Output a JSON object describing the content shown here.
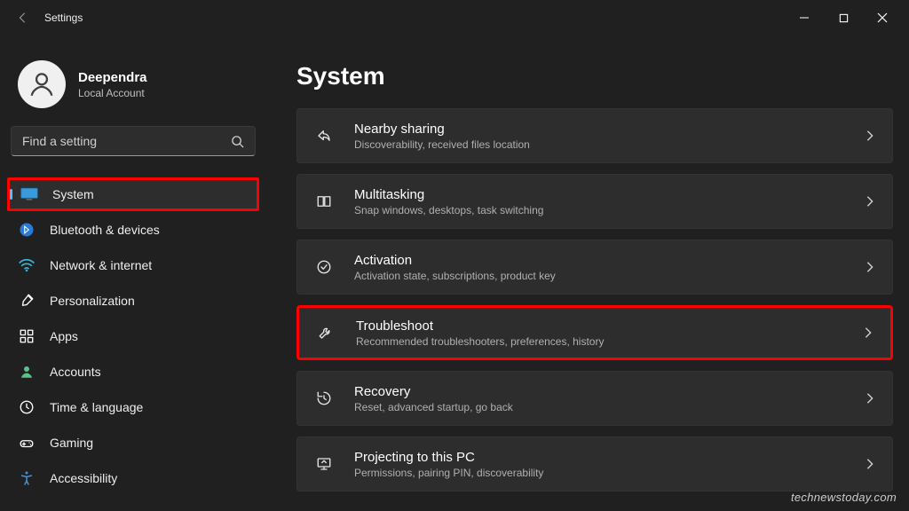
{
  "app_title": "Settings",
  "user": {
    "name": "Deependra",
    "subtitle": "Local Account"
  },
  "search": {
    "placeholder": "Find a setting"
  },
  "nav": {
    "items": [
      {
        "label": "System",
        "icon": "monitor-icon",
        "active": true,
        "highlight": true
      },
      {
        "label": "Bluetooth & devices",
        "icon": "bluetooth-icon"
      },
      {
        "label": "Network & internet",
        "icon": "wifi-icon"
      },
      {
        "label": "Personalization",
        "icon": "brush-icon"
      },
      {
        "label": "Apps",
        "icon": "apps-icon"
      },
      {
        "label": "Accounts",
        "icon": "person-icon"
      },
      {
        "label": "Time & language",
        "icon": "clock-icon"
      },
      {
        "label": "Gaming",
        "icon": "gamepad-icon"
      },
      {
        "label": "Accessibility",
        "icon": "accessibility-icon"
      }
    ]
  },
  "page": {
    "title": "System",
    "cards": [
      {
        "title": "Nearby sharing",
        "subtitle": "Discoverability, received files location",
        "icon": "share-icon"
      },
      {
        "title": "Multitasking",
        "subtitle": "Snap windows, desktops, task switching",
        "icon": "multitask-icon"
      },
      {
        "title": "Activation",
        "subtitle": "Activation state, subscriptions, product key",
        "icon": "activation-icon"
      },
      {
        "title": "Troubleshoot",
        "subtitle": "Recommended troubleshooters, preferences, history",
        "icon": "wrench-icon",
        "highlight": true
      },
      {
        "title": "Recovery",
        "subtitle": "Reset, advanced startup, go back",
        "icon": "recovery-icon"
      },
      {
        "title": "Projecting to this PC",
        "subtitle": "Permissions, pairing PIN, discoverability",
        "icon": "project-icon"
      }
    ]
  },
  "watermark": "technewstoday.com",
  "colors": {
    "accent": "#4cc2ff",
    "highlight": "#ff0000"
  }
}
